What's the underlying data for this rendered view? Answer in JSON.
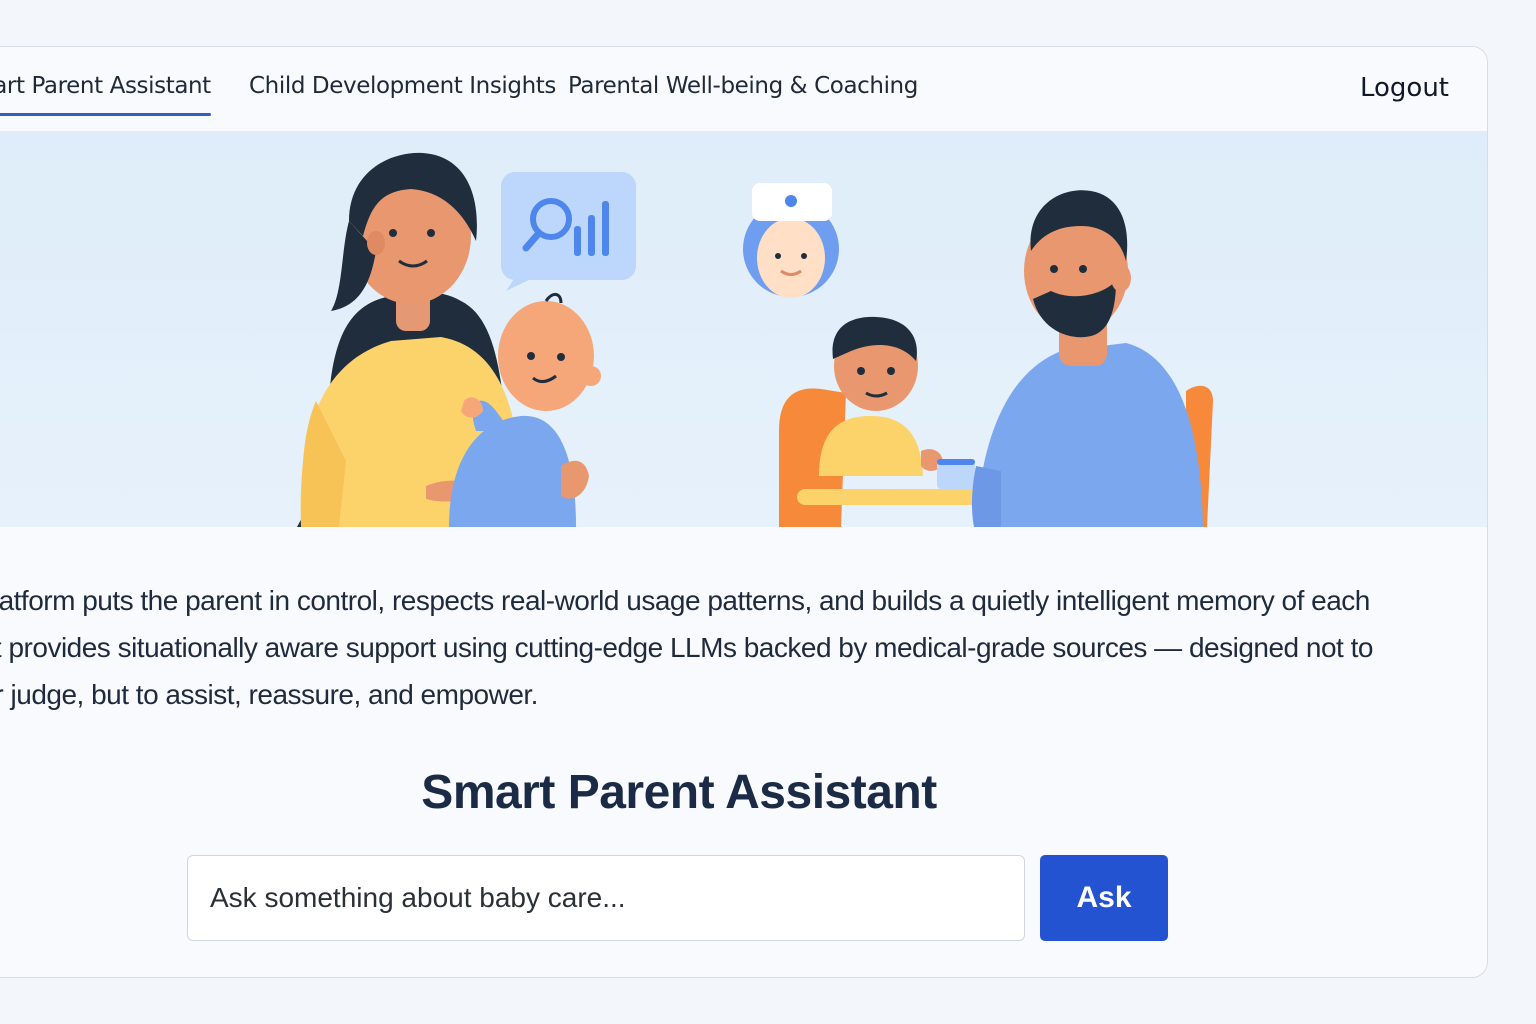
{
  "nav": {
    "tabs": [
      {
        "label": "Smart Parent Assistant",
        "active": true
      },
      {
        "label": "Child Development Insights",
        "active": false
      },
      {
        "label": "Parental Well-being & Coaching",
        "active": false
      }
    ],
    "logout_label": "Logout"
  },
  "hero": {
    "illustration": "parents-with-children-and-doctor",
    "icons": [
      "search-chart-icon",
      "doctor-avatar-icon"
    ]
  },
  "description": {
    "lines": [
      "s platform puts the parent in control, respects real-world usage patterns, and builds a quietly intelligent memory of each",
      "d. It provides situationally aware support using cutting-edge LLMs backed by medical-grade sources — designed not to",
      "g or judge, but to assist, reassure, and empower."
    ]
  },
  "assistant": {
    "title": "Smart Parent Assistant",
    "input_value": "",
    "input_placeholder": "Ask something about baby care...",
    "ask_label": "Ask"
  },
  "colors": {
    "accent": "#2453d1",
    "tab_underline": "#2f5fc4",
    "title": "#1c2b45",
    "hero_bg": "#e3eefa"
  }
}
